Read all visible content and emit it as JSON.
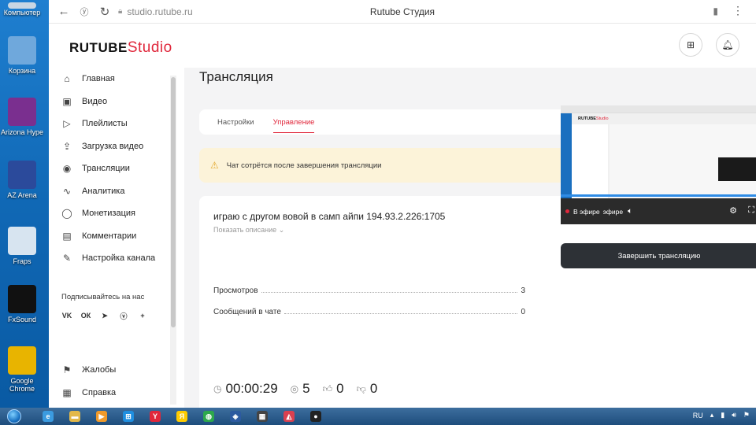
{
  "desktop": {
    "icons": [
      {
        "label": "Компьютер",
        "color": "#c9d6e3"
      },
      {
        "label": "Корзина",
        "color": "#6fa8dc"
      },
      {
        "label": "Arizona Hype",
        "color": "#7a2f8f"
      },
      {
        "label": "AZ Arena",
        "color": "#2b4a9b"
      },
      {
        "label": "Fraps",
        "color": "#d7e4f0"
      },
      {
        "label": "FxSound",
        "color": "#111111"
      },
      {
        "label": "Google Chrome",
        "color": "#e8b400"
      }
    ]
  },
  "browser": {
    "url": "studio.rutube.ru",
    "tab_title": "Rutube Студия"
  },
  "header": {
    "logo_main": "RUTUBE",
    "logo_accent": "Studio"
  },
  "sidebar": {
    "items": [
      {
        "label": "Главная",
        "icon": "home-icon",
        "glyph": "⌂"
      },
      {
        "label": "Видео",
        "icon": "video-icon",
        "glyph": "▣"
      },
      {
        "label": "Плейлисты",
        "icon": "playlist-icon",
        "glyph": "▷"
      },
      {
        "label": "Загрузка видео",
        "icon": "upload-icon",
        "glyph": "⇪"
      },
      {
        "label": "Трансляции",
        "icon": "broadcast-icon",
        "glyph": "◉"
      },
      {
        "label": "Аналитика",
        "icon": "analytics-icon",
        "glyph": "∿"
      },
      {
        "label": "Монетизация",
        "icon": "monetization-icon",
        "glyph": "◯"
      },
      {
        "label": "Комментарии",
        "icon": "comments-icon",
        "glyph": "▤"
      },
      {
        "label": "Настройка канала",
        "icon": "channel-settings-icon",
        "glyph": "✎"
      }
    ],
    "follow_title": "Подписывайтесь на нас",
    "socials": [
      "VK",
      "ОК",
      "➤",
      "ⓥ",
      "+"
    ],
    "bottom_items": [
      {
        "label": "Жалобы",
        "icon": "complaints-icon",
        "glyph": "⚑"
      },
      {
        "label": "Справка",
        "icon": "help-icon",
        "glyph": "▦"
      }
    ]
  },
  "main": {
    "page_title": "Трансляция",
    "tabs": [
      {
        "label": "Настройки",
        "active": false
      },
      {
        "label": "Управление",
        "active": true
      }
    ],
    "warning_text": "Чат сотрётся после завершения трансляции",
    "stream": {
      "title": "играю с другом вовой в самп айпи 194.93.2.226:1705",
      "show_description": "Показать описание",
      "stats": [
        {
          "label": "Просмотров",
          "value": "3"
        },
        {
          "label": "Сообщений в чате",
          "value": "0"
        }
      ],
      "duration": "00:00:29",
      "viewers": "5",
      "likes": "0",
      "dislikes": "0",
      "live_label": "В эфире",
      "live_label_overlay": "эфире",
      "progress": 1.0,
      "mini_logo": "RUTUBE",
      "mini_logo_accent": "Studio"
    },
    "end_button": "Завершить трансляцию"
  },
  "taskbar": {
    "apps": [
      {
        "name": "ie-app",
        "color": "#3b9be0",
        "glyph": "e"
      },
      {
        "name": "explorer-app",
        "color": "#e2b84a",
        "glyph": "▬"
      },
      {
        "name": "media-player-app",
        "color": "#f09a2a",
        "glyph": "▶"
      },
      {
        "name": "windows-app",
        "color": "#1f8fe0",
        "glyph": "⊞"
      },
      {
        "name": "yandex-browser-app",
        "color": "#e0273b",
        "glyph": "Y"
      },
      {
        "name": "yandex-app",
        "color": "#ffcc00",
        "glyph": "Я"
      },
      {
        "name": "chrome-app",
        "color": "#2da84c",
        "glyph": "◍"
      },
      {
        "name": "shield-app",
        "color": "#2c5aa0",
        "glyph": "◈"
      },
      {
        "name": "game-app",
        "color": "#444444",
        "glyph": "▦"
      },
      {
        "name": "rutube-app",
        "color": "#d94050",
        "glyph": "◭"
      },
      {
        "name": "obs-app",
        "color": "#222222",
        "glyph": "●"
      }
    ],
    "lang": "RU"
  },
  "colors": {
    "accent": "#e0273b",
    "warning_bg": "#fcf3d9",
    "dark_button": "#2d3136"
  }
}
